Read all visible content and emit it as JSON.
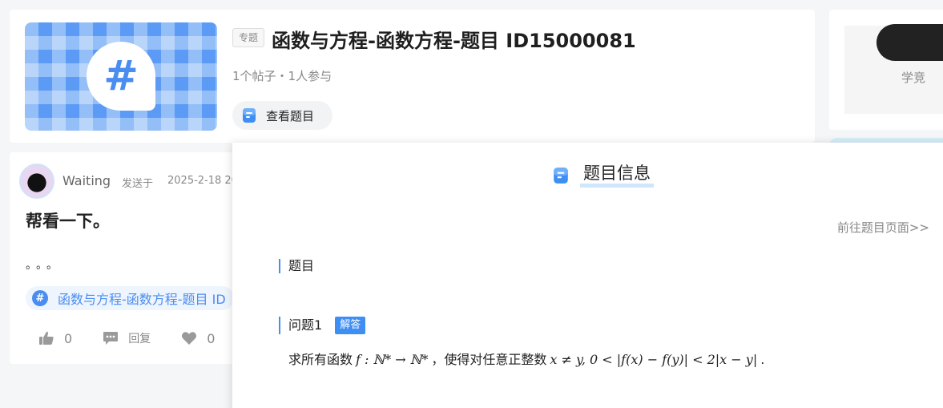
{
  "topic": {
    "tag": "专题",
    "title": "函数与方程-函数方程-题目 ID15000081",
    "stats": "1个帖子・1人参与",
    "view_button": "查看题目"
  },
  "side": {
    "text": "学竞"
  },
  "post": {
    "author": "Waiting",
    "sent_label": "发送于",
    "date": "2025-2-18 20",
    "title": "帮看一下。",
    "body": "。。。",
    "topic_label": "函数与方程-函数方程-题目 ID",
    "likes": "0",
    "reply_label": "回复",
    "favorites": "0"
  },
  "panel": {
    "title": "题目信息",
    "goto_link": "前往题目页面>>",
    "section_question": "题目",
    "problem_label": "问题1",
    "answer_badge": "解答",
    "question_prefix": "求所有函数",
    "question_math_1": "f : ℕ* → ℕ*",
    "question_mid": "，使得对任意正整数",
    "question_math_2": "x ≠ y, 0 < |f(x) − f(y)| < 2|x − y|",
    "question_end": "."
  },
  "colors": {
    "accent": "#4a8df0",
    "badge": "#3f8ef4",
    "background": "#f5f6f7"
  }
}
